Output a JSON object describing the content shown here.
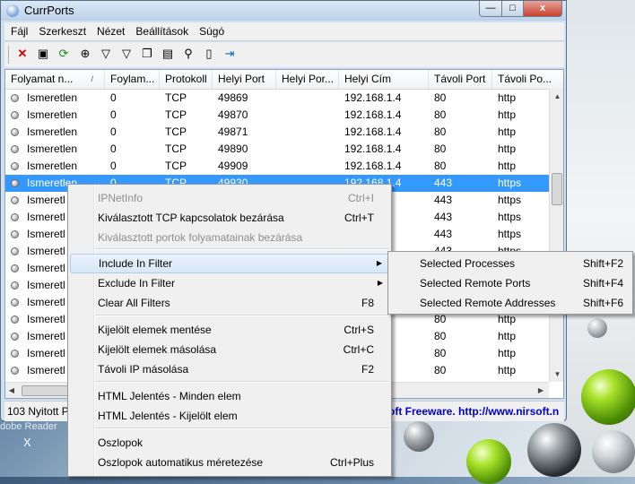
{
  "window": {
    "title": "CurrPorts",
    "close_label": "x",
    "max_label": "□",
    "min_label": "—"
  },
  "menubar": {
    "items": [
      "Fájl",
      "Szerkeszt",
      "Nézet",
      "Beállítások",
      "Súgó"
    ]
  },
  "toolbar": {
    "icons": [
      "delete-x-icon",
      "save-icon",
      "refresh-icon",
      "target-icon",
      "filter-icon",
      "filter-edit-icon",
      "copy-icon",
      "properties-icon",
      "find-icon",
      "report-icon",
      "exit-icon"
    ]
  },
  "columns": [
    "Folyamat n...",
    "Foylam...",
    "Protokoll",
    "Helyi Port",
    "Helyi Por...",
    "Helyi Cím",
    "Távoli Port",
    "Távoli Po..."
  ],
  "rows": [
    [
      "Ismeretlen",
      "0",
      "TCP",
      "49869",
      "",
      "192.168.1.4",
      "80",
      "http"
    ],
    [
      "Ismeretlen",
      "0",
      "TCP",
      "49870",
      "",
      "192.168.1.4",
      "80",
      "http"
    ],
    [
      "Ismeretlen",
      "0",
      "TCP",
      "49871",
      "",
      "192.168.1.4",
      "80",
      "http"
    ],
    [
      "Ismeretlen",
      "0",
      "TCP",
      "49890",
      "",
      "192.168.1.4",
      "80",
      "http"
    ],
    [
      "Ismeretlen",
      "0",
      "TCP",
      "49909",
      "",
      "192.168.1.4",
      "80",
      "http"
    ],
    [
      "Ismeretlen",
      "0",
      "TCP",
      "49930",
      "",
      "192.168.1.4",
      "443",
      "https"
    ],
    [
      "Ismeretl",
      "",
      "",
      "",
      "",
      "",
      "443",
      "https"
    ],
    [
      "Ismeretl",
      "",
      "",
      "",
      "",
      "",
      "443",
      "https"
    ],
    [
      "Ismeretl",
      "",
      "",
      "",
      "",
      "",
      "443",
      "https"
    ],
    [
      "Ismeretl",
      "",
      "",
      "",
      "",
      "",
      "443",
      "https"
    ],
    [
      "Ismeretl",
      "",
      "",
      "",
      "",
      "",
      "",
      ""
    ],
    [
      "Ismeretl",
      "",
      "",
      "",
      "",
      "",
      "",
      ""
    ],
    [
      "Ismeretl",
      "",
      "",
      "",
      "",
      "",
      "",
      ""
    ],
    [
      "Ismeretl",
      "",
      "",
      "",
      "",
      "",
      "80",
      "http"
    ],
    [
      "Ismeretl",
      "",
      "",
      "",
      "",
      "",
      "80",
      "http"
    ],
    [
      "Ismeretl",
      "",
      "",
      "",
      "",
      "",
      "80",
      "http"
    ],
    [
      "Ismeretl",
      "",
      "",
      "",
      "",
      "",
      "80",
      "http"
    ]
  ],
  "selected_row": 5,
  "status": {
    "count": "103 Nyitott P",
    "link": "oft Freeware.  http://www.nirsoft.n"
  },
  "context_menu": {
    "items": [
      {
        "label": "IPNetInfo",
        "key": "Ctrl+I",
        "disabled": true
      },
      {
        "label": "Kiválasztott TCP kapcsolatok bezárása",
        "key": "Ctrl+T"
      },
      {
        "label": "Kiválasztott portok folyamatainak bezárása",
        "key": "",
        "disabled": true
      },
      {
        "label": "Include In Filter",
        "key": "",
        "submenu": true,
        "highlighted": true
      },
      {
        "label": "Exclude In Filter",
        "key": "",
        "submenu": true
      },
      {
        "label": "Clear All Filters",
        "key": "F8"
      },
      {
        "label": "Kijelölt elemek mentése",
        "key": "Ctrl+S"
      },
      {
        "label": "Kijelölt elemek másolása",
        "key": "Ctrl+C"
      },
      {
        "label": "Távoli IP másolása",
        "key": "F2"
      },
      {
        "label": "HTML Jelentés - Minden elem",
        "key": ""
      },
      {
        "label": "HTML Jelentés - Kijelölt elem",
        "key": ""
      },
      {
        "label": "Oszlopok",
        "key": ""
      },
      {
        "label": "Oszlopok automatikus méretezése",
        "key": "Ctrl+Plus"
      }
    ],
    "submenu_arrow": "▶"
  },
  "submenu": {
    "items": [
      {
        "label": "Selected Processes",
        "key": "Shift+F2"
      },
      {
        "label": "Selected Remote Ports",
        "key": "Shift+F4"
      },
      {
        "label": "Selected Remote Addresses",
        "key": "Shift+F6"
      }
    ]
  },
  "desktop": {
    "taskbar_label": "dobe Reader",
    "taskbar_close": "X"
  }
}
